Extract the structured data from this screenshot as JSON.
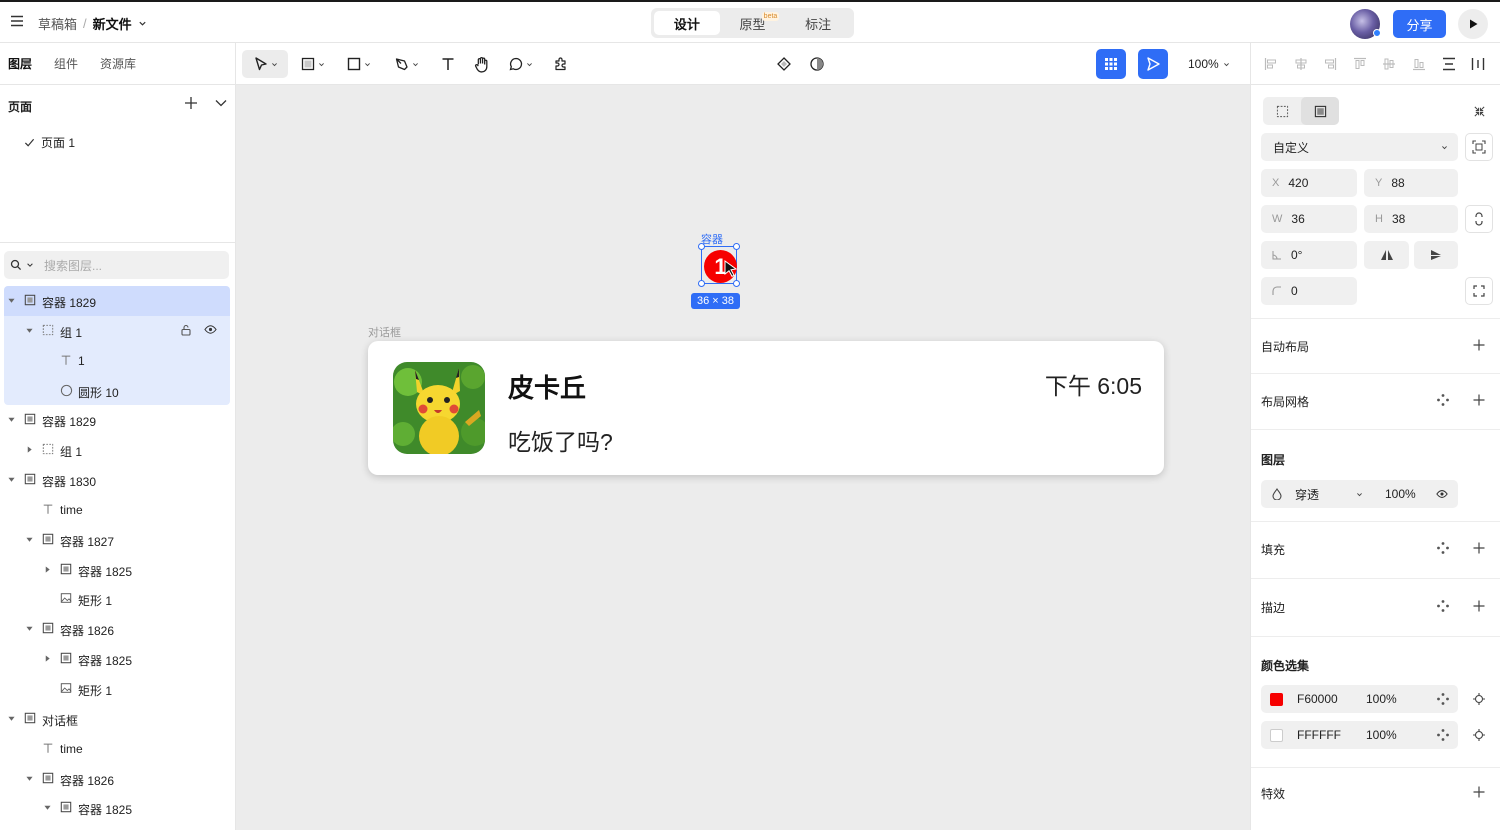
{
  "header": {
    "breadcrumb_root": "草稿箱",
    "breadcrumb_sep": "/",
    "file_name": "新文件",
    "mode_tabs": [
      "设计",
      "原型",
      "标注"
    ],
    "beta_badge": "beta",
    "share_label": "分享"
  },
  "toolbar": {
    "zoom": "100%"
  },
  "left_panel": {
    "tabs": [
      "图层",
      "组件",
      "资源库"
    ],
    "pages_title": "页面",
    "pages": [
      "页面 1"
    ],
    "search_placeholder": "搜索图层...",
    "layers": [
      {
        "name": "容器 1829",
        "icon": "frame-icon",
        "indent": 0,
        "expand": "open",
        "state": "sel"
      },
      {
        "name": "组 1",
        "icon": "group-icon",
        "indent": 1,
        "expand": "open",
        "state": "child"
      },
      {
        "name": "1",
        "icon": "text-icon",
        "indent": 2,
        "expand": "none",
        "state": "child"
      },
      {
        "name": "圆形 10",
        "icon": "ellipse-icon",
        "indent": 2,
        "expand": "none",
        "state": "child"
      },
      {
        "name": "容器 1829",
        "icon": "frame-icon",
        "indent": 0,
        "expand": "open",
        "state": ""
      },
      {
        "name": "组 1",
        "icon": "group-icon",
        "indent": 1,
        "expand": "closed",
        "state": ""
      },
      {
        "name": "容器 1830",
        "icon": "frame-icon",
        "indent": 0,
        "expand": "open",
        "state": ""
      },
      {
        "name": "time",
        "icon": "text-icon",
        "indent": 1,
        "expand": "none",
        "state": ""
      },
      {
        "name": "容器 1827",
        "icon": "frame-icon",
        "indent": 1,
        "expand": "open",
        "state": ""
      },
      {
        "name": "容器 1825",
        "icon": "frame-icon",
        "indent": 2,
        "expand": "closed",
        "state": ""
      },
      {
        "name": "矩形 1",
        "icon": "image-icon",
        "indent": 2,
        "expand": "none",
        "state": ""
      },
      {
        "name": "容器 1826",
        "icon": "frame-icon",
        "indent": 1,
        "expand": "open",
        "state": ""
      },
      {
        "name": "容器 1825",
        "icon": "frame-icon",
        "indent": 2,
        "expand": "closed",
        "state": ""
      },
      {
        "name": "矩形 1",
        "icon": "image-icon",
        "indent": 2,
        "expand": "none",
        "state": ""
      },
      {
        "name": "对话框",
        "icon": "frame-icon",
        "indent": 0,
        "expand": "open",
        "state": ""
      },
      {
        "name": "time",
        "icon": "text-icon",
        "indent": 1,
        "expand": "none",
        "state": ""
      },
      {
        "name": "容器 1826",
        "icon": "frame-icon",
        "indent": 1,
        "expand": "open",
        "state": ""
      },
      {
        "name": "容器 1825",
        "icon": "frame-icon",
        "indent": 2,
        "expand": "open",
        "state": ""
      }
    ]
  },
  "canvas": {
    "frame_label": "对话框",
    "contact_name": "皮卡丘",
    "message": "吃饭了吗?",
    "time": "下午 6:05",
    "container_label": "容器",
    "badge_text": "1",
    "size_tag": "36 × 38",
    "help": "?"
  },
  "right_panel": {
    "preset": "自定义",
    "x_label": "X",
    "x": "420",
    "y_label": "Y",
    "y": "88",
    "w_label": "W",
    "w": "36",
    "h_label": "H",
    "h": "38",
    "rotation": "0°",
    "radius": "0",
    "sections": {
      "auto_layout": "自动布局",
      "layout_grid": "布局网格",
      "layer": "图层",
      "fill": "填充",
      "stroke": "描边",
      "color_selection": "颜色选集",
      "effects": "特效"
    },
    "blend_mode": "穿透",
    "layer_opacity": "100%",
    "colors": [
      {
        "hex": "F60000",
        "opacity": "100%",
        "swatch": "#F60000"
      },
      {
        "hex": "FFFFFF",
        "opacity": "100%",
        "swatch": "#FFFFFF"
      }
    ]
  },
  "theme": {
    "accent": "#2f6df6",
    "selection": "#cfdcfd",
    "badge": "#f60000"
  }
}
